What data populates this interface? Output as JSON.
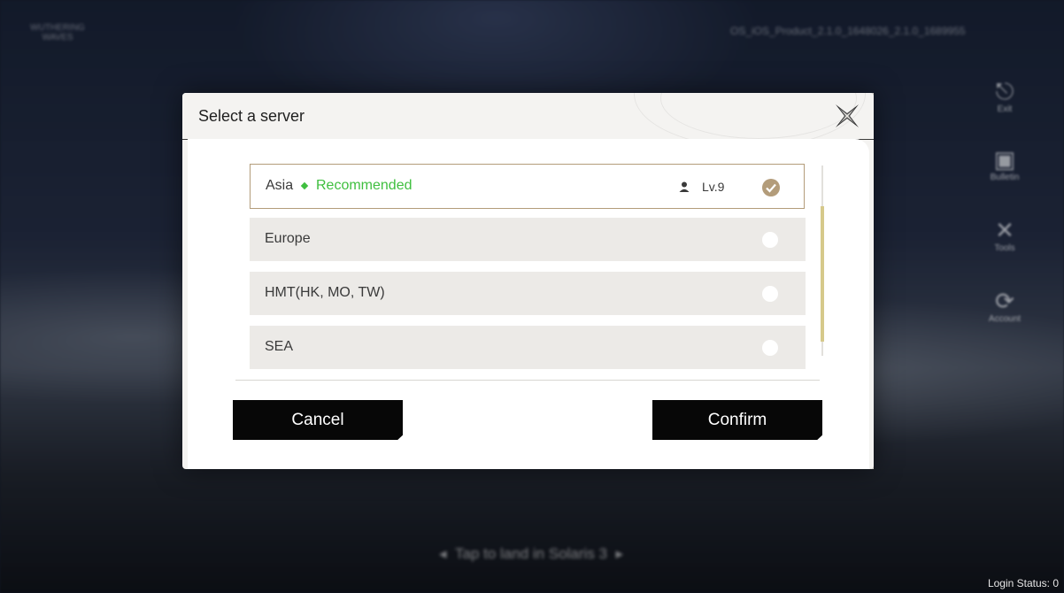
{
  "background": {
    "top_left_logo": "WUTHERING WAVES",
    "build_string": "OS_iOS_Product_2.1.0_1648026_2.1.0_1689955",
    "side_menu": [
      {
        "icon": "exit-icon",
        "label": "Exit"
      },
      {
        "icon": "bulletin-icon",
        "label": "Bulletin"
      },
      {
        "icon": "tools-icon",
        "label": "Tools"
      },
      {
        "icon": "account-icon",
        "label": "Account"
      }
    ],
    "bottom_hint": "Tap to land in Solaris 3",
    "login_status": "Login Status: 0"
  },
  "dialog": {
    "title": "Select a server",
    "close_icon": "close-x-icon",
    "servers": [
      {
        "name": "Asia",
        "badge": "Recommended",
        "level": "Lv.9",
        "selected": true
      },
      {
        "name": "Europe",
        "selected": false
      },
      {
        "name": "HMT(HK, MO, TW)",
        "selected": false
      },
      {
        "name": "SEA",
        "selected": false
      }
    ],
    "cancel_label": "Cancel",
    "confirm_label": "Confirm"
  },
  "colors": {
    "accent_gold": "#b39c7a",
    "recommended_green": "#3fbf3f",
    "button_black": "#070707",
    "scroll_thumb": "#d6c98b"
  }
}
